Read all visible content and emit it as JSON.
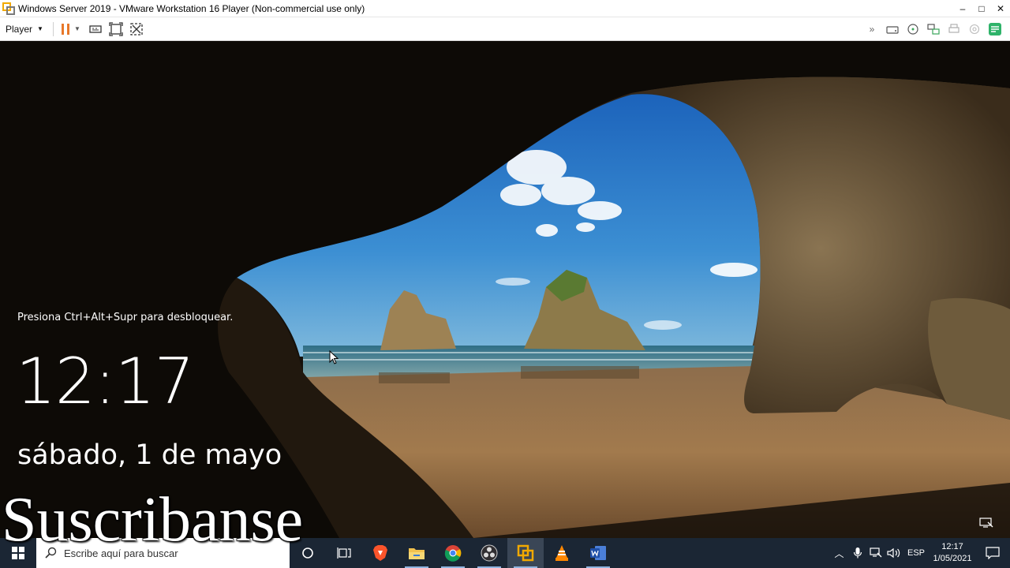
{
  "window": {
    "title": "Windows Server 2019 - VMware Workstation 16 Player (Non-commercial use only)",
    "minimize_glyph": "–",
    "maximize_glyph": "□",
    "close_glyph": "✕"
  },
  "toolbar": {
    "player_menu_label": "Player",
    "left_icons": [
      "pause-icon",
      "send-ctrl-alt-del-icon",
      "fit-guest-icon",
      "unity-icon"
    ],
    "right_icons": [
      "more-chevrons-icon",
      "hard-disk-icon",
      "cd-dvd-icon",
      "network-adapter-icon",
      "printer-icon",
      "sound-icon",
      "message-log-icon"
    ]
  },
  "lock_screen": {
    "hint": "Presiona Ctrl+Alt+Supr para desbloquear.",
    "time": "12:17",
    "date": "sábado, 1 de mayo"
  },
  "taskbar": {
    "search_placeholder": "Escribe aquí para buscar",
    "apps": [
      "cortana-icon",
      "task-view-icon",
      "brave-browser-icon",
      "file-explorer-icon",
      "chrome-icon",
      "obs-studio-icon",
      "vmware-player-icon",
      "vlc-icon",
      "word-icon"
    ],
    "tray": {
      "language": "ESP",
      "clock_time": "12:17",
      "clock_date": "1/05/2021"
    }
  },
  "overlay": {
    "text": "Suscribanse"
  },
  "colors": {
    "taskbar": "#1b2634",
    "pause_accent": "#e8782a",
    "sky": "#2c7fd0",
    "sand": "#a97c4c"
  }
}
